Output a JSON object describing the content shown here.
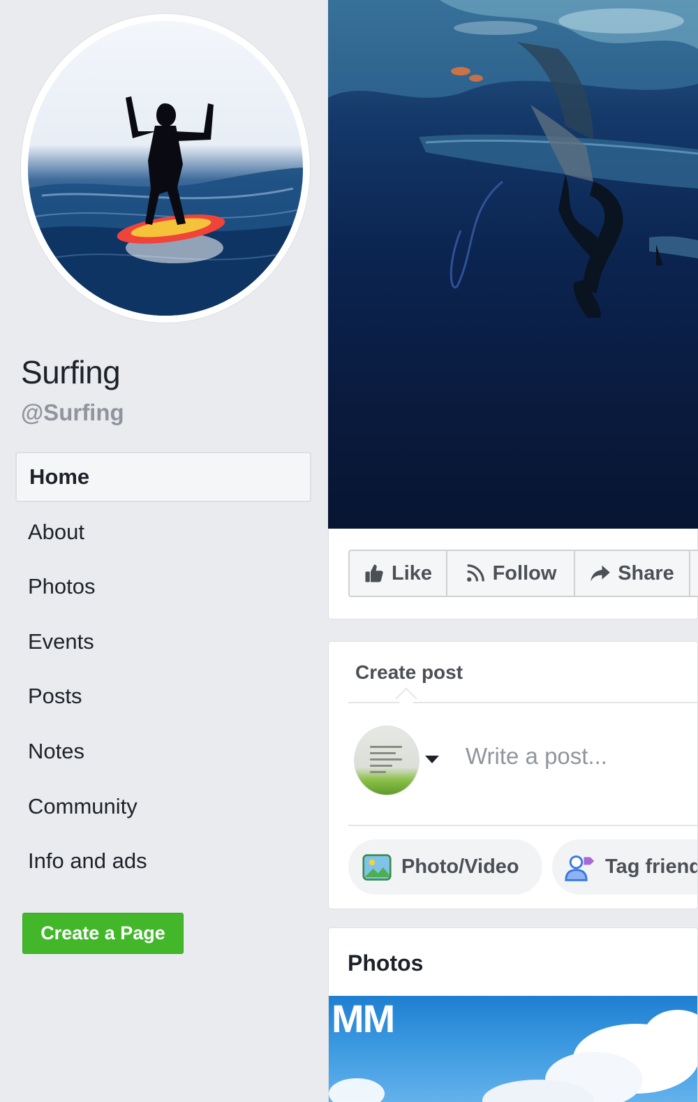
{
  "page": {
    "name": "Surfing",
    "handle": "@Surfing"
  },
  "nav": {
    "items": [
      {
        "label": "Home",
        "active": true
      },
      {
        "label": "About"
      },
      {
        "label": "Photos"
      },
      {
        "label": "Events"
      },
      {
        "label": "Posts"
      },
      {
        "label": "Notes"
      },
      {
        "label": "Community"
      },
      {
        "label": "Info and ads"
      }
    ]
  },
  "create_page_button": "Create a Page",
  "actions": {
    "like": "Like",
    "follow": "Follow",
    "share": "Share"
  },
  "composer": {
    "tab_label": "Create post",
    "placeholder": "Write a post...",
    "photo_video": "Photo/Video",
    "tag_friends": "Tag friends"
  },
  "photos": {
    "title": "Photos",
    "thumb_text": "MM"
  },
  "colors": {
    "background": "#e9ebee",
    "create_page_green": "#42b72a",
    "muted_text": "#90949c"
  },
  "icons": [
    "like-icon",
    "rss-follow-icon",
    "share-arrow-icon",
    "photo-video-icon",
    "tag-friends-icon",
    "caret-down-icon"
  ]
}
